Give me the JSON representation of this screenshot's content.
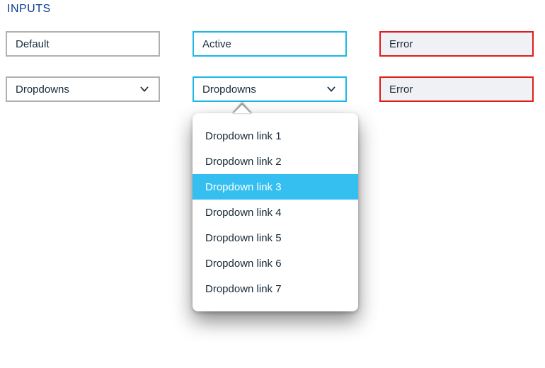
{
  "section_title": "INPUTS",
  "row1": {
    "default_value": "Default",
    "active_value": "Active",
    "error_value": "Error"
  },
  "row2": {
    "dropdown_default_value": "Dropdowns",
    "dropdown_active_value": "Dropdowns",
    "error_value": "Error"
  },
  "menu": {
    "items": [
      "Dropdown link 1",
      "Dropdown link 2",
      "Dropdown link 3",
      "Dropdown link 4",
      "Dropdown link 5",
      "Dropdown link 6",
      "Dropdown link 7"
    ],
    "selected_index": 2
  },
  "colors": {
    "brand_accent": "#1ab9e6",
    "error": "#e11a1a",
    "heading": "#0a3b8f",
    "highlight": "#34bff0"
  }
}
